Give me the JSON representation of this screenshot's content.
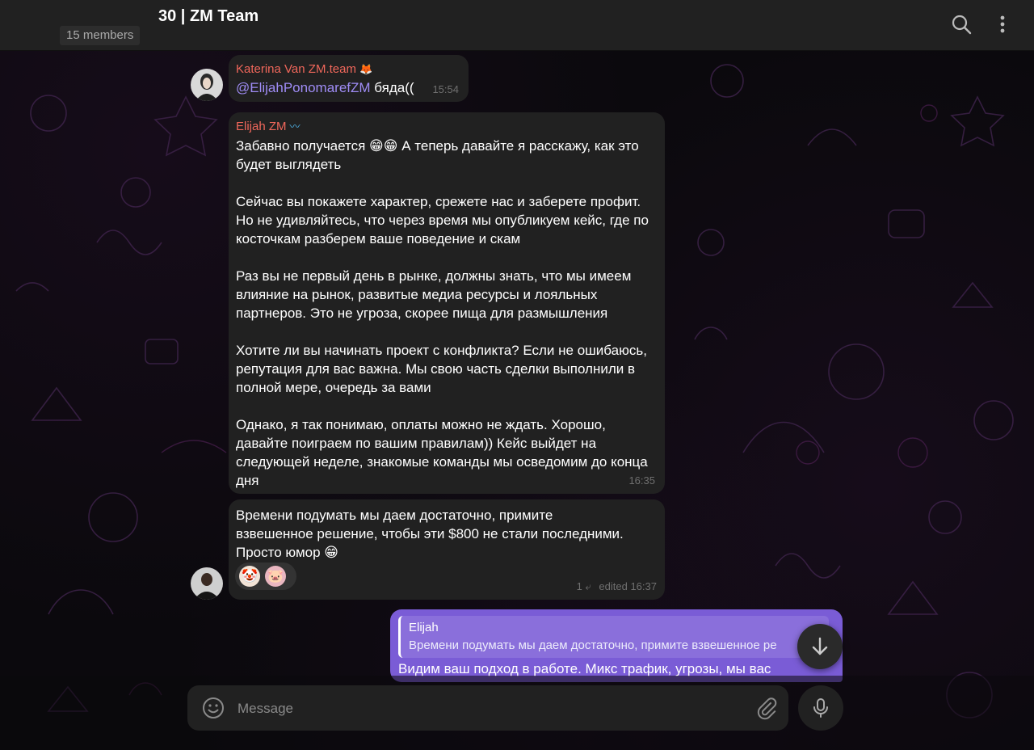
{
  "header": {
    "title": "30 | ZM Team",
    "members": "15 members",
    "search_icon": "search-icon",
    "more_icon": "more-vertical-icon"
  },
  "messages": [
    {
      "sender": "Katerina Van ZM.team",
      "sender_emblem": "🦊",
      "mention": "@ElijahPonomarefZM",
      "text": "бяда((",
      "time": "15:54"
    },
    {
      "sender": "Elijah ZM",
      "sender_emblem": "〰",
      "paragraphs": [
        "Забавно получается 😁😁 А теперь давайте я расскажу, как это будет выглядеть",
        "Сейчас вы покажете характер, срежете нас и заберете профит. Но не удивляйтесь, что через время мы опубликуем кейс, где по косточкам разберем ваше поведение и скам",
        "Раз вы не первый день в рынке, должны знать, что мы имеем влияние на рынок, развитые медиа ресурсы и лояльных партнеров. Это не угроза, скорее пища для размышления",
        "Хотите ли вы начинать проект с конфликта? Если не ошибаюсь, репутация для вас важна. Мы свою часть сделки выполнили в полной мере, очередь за вами",
        "Однако, я так понимаю, оплаты можно не ждать. Хорошо, давайте поиграем по вашим правилам)) Кейс выйдет на следующей неделе, знакомые команды мы осведомим до конца дня"
      ],
      "time": "16:35"
    },
    {
      "text_lines": [
        "Времени подумать мы даем достаточно, примите",
        "взвешенное решение, чтобы эти $800 не стали последними.",
        "Просто юмор 😁"
      ],
      "reactions": [
        "🤡",
        "🐷"
      ],
      "reply_count": "1",
      "meta": "edited 16:37"
    }
  ],
  "outgoing": {
    "reply_name": "Elijah",
    "reply_text": "Времени подумать мы даем достаточно, примите взвешенное ре",
    "text": "Видим ваш подход в работе. Микс трафик, угрозы, мы вас"
  },
  "composer": {
    "placeholder": "Message"
  },
  "colors": {
    "bubble": "#212121",
    "outgoing": "#7a5cd6",
    "sender": "#f0675b",
    "mention": "#9f8cf5"
  }
}
